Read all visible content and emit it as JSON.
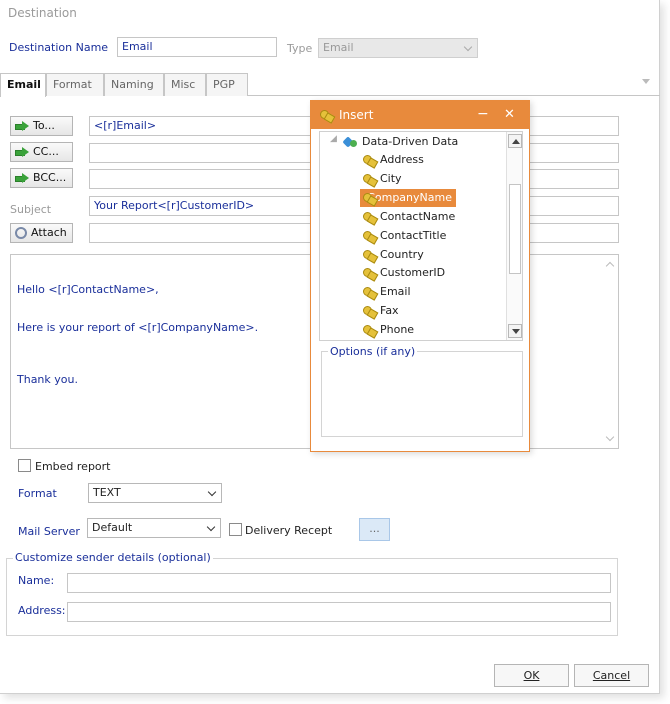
{
  "window_title": "Destination",
  "destination_name": {
    "label": "Destination Name",
    "value": "Email"
  },
  "type": {
    "label": "Type",
    "value": "Email"
  },
  "tabs": [
    {
      "label": "Email",
      "active": true
    },
    {
      "label": "Format",
      "active": false
    },
    {
      "label": "Naming",
      "active": false
    },
    {
      "label": "Misc",
      "active": false
    },
    {
      "label": "PGP",
      "active": false
    }
  ],
  "recipients": {
    "to_label": "To...",
    "to_value": "<[r]Email>",
    "cc_label": "CC...",
    "cc_value": "",
    "bcc_label": "BCC...",
    "bcc_value": ""
  },
  "subject": {
    "label": "Subject",
    "value": "Your Report<[r]CustomerID>"
  },
  "attach": {
    "label": "Attach",
    "value": ""
  },
  "message_lines": [
    "Hello <[r]ContactName>,",
    "Here is your report of <[r]CompanyName>.",
    "Thank you."
  ],
  "embed_report": {
    "label": "Embed report",
    "checked": false
  },
  "format": {
    "label": "Format",
    "value": "TEXT"
  },
  "mail_server": {
    "label": "Mail Server",
    "value": "Default"
  },
  "delivery_receipt": {
    "label": "Delivery Recept",
    "checked": false
  },
  "ellipsis_label": "...",
  "sender": {
    "group_label": "Customize sender details (optional)",
    "name_label": "Name:",
    "name_value": "",
    "address_label": "Address:",
    "address_value": ""
  },
  "ok_label": "OK",
  "cancel_label": "Cancel",
  "insert_popup": {
    "title": "Insert",
    "minimize": "−",
    "close": "✕",
    "root_label": "Data-Driven Data",
    "fields": [
      "Address",
      "City",
      "CompanyName",
      "ContactName",
      "ContactTitle",
      "Country",
      "CustomerID",
      "Email",
      "Fax",
      "Phone"
    ],
    "selected": "CompanyName",
    "options_label": "Options (if any)"
  },
  "colors": {
    "accent": "#e88a3c",
    "label_blue": "#1a2f9a",
    "selection": "#e88a3c"
  },
  "icons": [
    "green-arrow-icon",
    "paperclip-icon",
    "field-icon",
    "database-icon",
    "chevron-down-icon"
  ]
}
